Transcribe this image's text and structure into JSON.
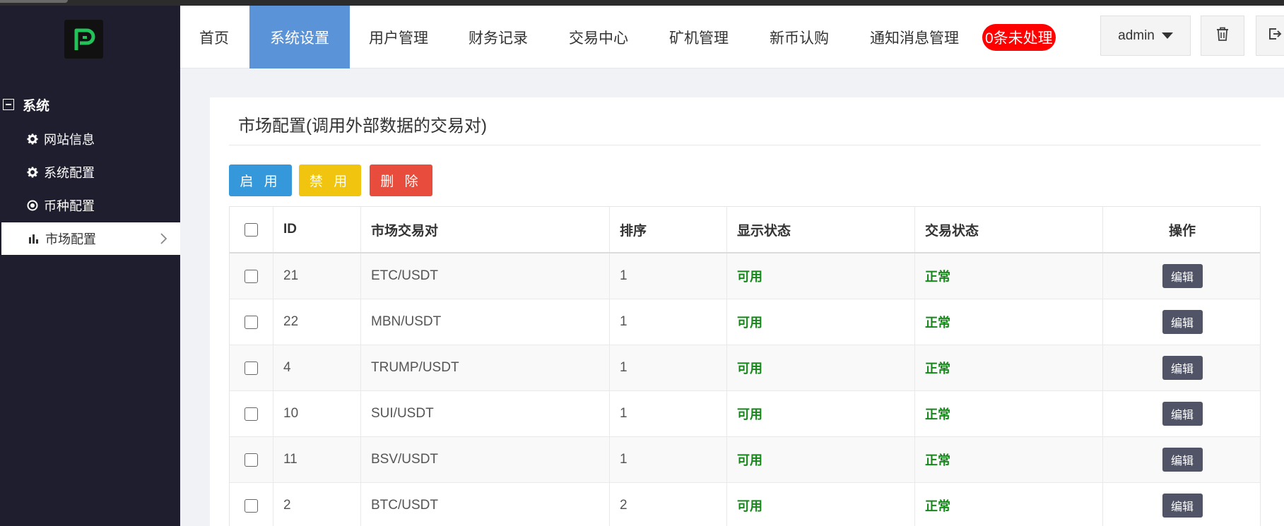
{
  "nav": {
    "items": [
      "首页",
      "系统设置",
      "用户管理",
      "财务记录",
      "交易中心",
      "矿机管理",
      "新币认购",
      "通知消息管理"
    ],
    "badge": "0条未处理",
    "user": "admin"
  },
  "sidebar": {
    "group": "系统",
    "items": [
      "网站信息",
      "系统配置",
      "币种配置",
      "市场配置"
    ]
  },
  "panel": {
    "title": "市场配置(调用外部数据的交易对)",
    "buttons": {
      "enable": "启 用",
      "disable": "禁 用",
      "delete": "删 除"
    },
    "columns": [
      "ID",
      "市场交易对",
      "排序",
      "显示状态",
      "交易状态",
      "操作"
    ],
    "rows": [
      {
        "id": "21",
        "pair": "ETC/USDT",
        "sort": "1",
        "display": "可用",
        "trade": "正常",
        "action": "编辑"
      },
      {
        "id": "22",
        "pair": "MBN/USDT",
        "sort": "1",
        "display": "可用",
        "trade": "正常",
        "action": "编辑"
      },
      {
        "id": "4",
        "pair": "TRUMP/USDT",
        "sort": "1",
        "display": "可用",
        "trade": "正常",
        "action": "编辑"
      },
      {
        "id": "10",
        "pair": "SUI/USDT",
        "sort": "1",
        "display": "可用",
        "trade": "正常",
        "action": "编辑"
      },
      {
        "id": "11",
        "pair": "BSV/USDT",
        "sort": "1",
        "display": "可用",
        "trade": "正常",
        "action": "编辑"
      },
      {
        "id": "2",
        "pair": "BTC/USDT",
        "sort": "2",
        "display": "可用",
        "trade": "正常",
        "action": "编辑"
      }
    ]
  },
  "colors": {
    "sidebar_bg": "#1f1e2e",
    "nav_active": "#5b93d8",
    "btn_enable": "#3498db",
    "btn_disable": "#f1c40f",
    "btn_delete": "#e74c3c",
    "status_green": "#17871c",
    "badge": "#ff0000",
    "edit_btn": "#505466",
    "logo_green": "#22c45a"
  },
  "icons": {
    "logo": "p-logo-icon",
    "group": "minus-square-icon",
    "site_info": "gear-icon",
    "sys_config": "gear-icon",
    "coin_config": "radio-circle-icon",
    "market_config": "bar-chart-icon",
    "user_menu": "caret-down-icon",
    "clear_cache": "trash-icon",
    "logout": "logout-icon"
  }
}
